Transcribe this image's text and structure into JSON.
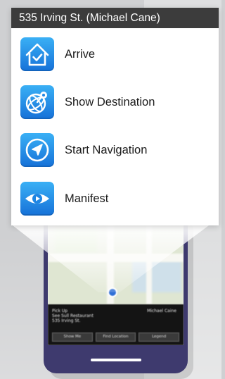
{
  "popup": {
    "title": "535 Irving St. (Michael Cane)",
    "actions": [
      {
        "label": "Arrive",
        "icon": "house-check-icon"
      },
      {
        "label": "Show Destination",
        "icon": "globe-pin-icon"
      },
      {
        "label": "Start Navigation",
        "icon": "navigation-arrow-icon"
      },
      {
        "label": "Manifest",
        "icon": "eye-icon"
      }
    ]
  },
  "phone": {
    "info": {
      "left_line1": "Pick Up",
      "left_line2": "See Sull Restaurant",
      "left_line3": "535 Irving St.",
      "right_line1": "Michael Caine"
    },
    "buttons": [
      "Show Me",
      "Find Location",
      "Legend"
    ]
  },
  "colors": {
    "header_bg": "#3c3c3c",
    "icon_gradient_top": "#3ab0f5",
    "icon_gradient_bottom": "#1671d8",
    "phone_body": "#3e3a6e",
    "page_bg": "#cfd0d2"
  }
}
